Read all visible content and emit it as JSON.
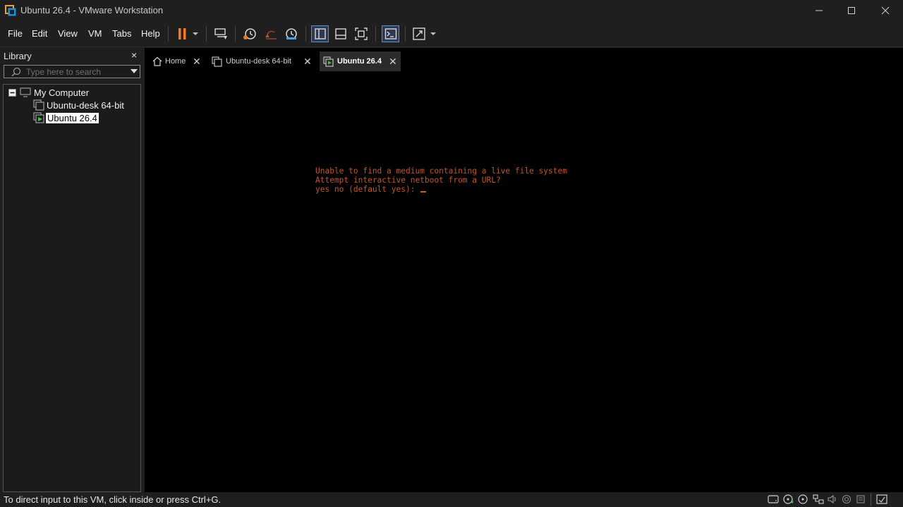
{
  "window": {
    "title": "Ubuntu 26.4 - VMware Workstation"
  },
  "menu": {
    "items": [
      "File",
      "Edit",
      "View",
      "VM",
      "Tabs",
      "Help"
    ]
  },
  "toolbar": {
    "icons": [
      "pause-icon",
      "dropdown-arrow-icon",
      "send-ctrl-alt-del-icon",
      "take-snapshot-icon",
      "revert-snapshot-icon",
      "snapshot-manager-icon",
      "show-library-icon",
      "thumbnail-bar-icon",
      "full-screen-icon",
      "console-view-icon",
      "stretch-guest-icon",
      "dropdown-arrow-icon"
    ],
    "accent": "#f07a26"
  },
  "library": {
    "title": "Library",
    "close": "×",
    "search_placeholder": "Type here to search",
    "tree": {
      "root": "My Computer",
      "items": [
        "Ubuntu-desk 64-bit",
        "Ubuntu 26.4"
      ],
      "selected": "Ubuntu 26.4"
    }
  },
  "tabs": [
    {
      "label": "Home",
      "close": "✕"
    },
    {
      "label": "Ubuntu-desk 64-bit",
      "close": "✕"
    },
    {
      "label": "Ubuntu 26.4",
      "close": "✕",
      "active": true
    }
  ],
  "console": {
    "lines": [
      "Unable to find a medium containing a live file system",
      "Attempt interactive netboot from a URL?",
      "yes no (default yes): "
    ],
    "text_color": "#c0552a"
  },
  "statusbar": {
    "text": "To direct input to this VM, click inside or press Ctrl+G.",
    "icons": [
      "hard-disk-icon",
      "cd-rom-icon",
      "cd-rom-2-icon",
      "network-icon",
      "usb-icon",
      "sound-icon",
      "printer-icon",
      "messages-icon",
      "fit-guest-icon"
    ]
  }
}
